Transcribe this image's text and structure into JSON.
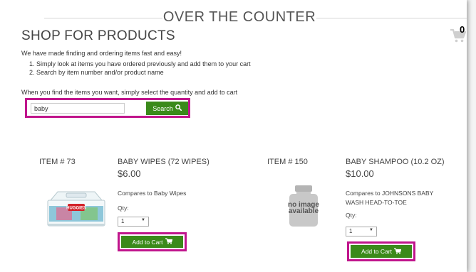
{
  "header": {
    "section_title": "OVER THE COUNTER",
    "page_title": "SHOP FOR PRODUCTS",
    "cart_count": "0"
  },
  "intro": {
    "text": "We have made finding and ordering items fast and easy!",
    "steps": [
      "Simply look at items you have ordered previously and add them to your cart",
      "Search by item number and/or product name"
    ],
    "instruction": "When you find the items you want, simply select the quantity and add to cart"
  },
  "search": {
    "value": "baby",
    "button_label": "Search"
  },
  "products": [
    {
      "item_number": "ITEM # 73",
      "name": "BABY WIPES (72 WIPES)",
      "price": "$6.00",
      "compares": "Compares to Baby Wipes",
      "qty_label": "Qty:",
      "qty_value": "1",
      "add_label": "Add to Cart",
      "image_brand": "HUGGIES"
    },
    {
      "item_number": "ITEM # 150",
      "name": "BABY SHAMPOO (10.2 OZ)",
      "price": "$10.00",
      "compares": "Compares to JOHNSONS BABY WASH HEAD-TO-TOE",
      "qty_label": "Qty:",
      "qty_value": "1",
      "add_label": "Add to Cart",
      "image_placeholder": [
        "no image",
        "available"
      ]
    }
  ],
  "colors": {
    "accent_green": "#3a8a1a",
    "highlight_magenta": "#c0158c"
  }
}
